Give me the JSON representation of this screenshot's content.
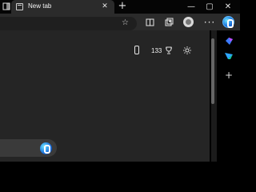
{
  "tab": {
    "title": "New tab",
    "close_symbol": "✕"
  },
  "toolbar": {
    "favorite_symbol": "☆"
  },
  "new_tab": {
    "symbol": "+"
  },
  "window": {
    "minimize_symbol": "—",
    "maximize_symbol": "▢",
    "close_symbol": "✕"
  },
  "page": {
    "rewards_points": "133"
  },
  "sidebar": {
    "add_symbol": "+"
  }
}
